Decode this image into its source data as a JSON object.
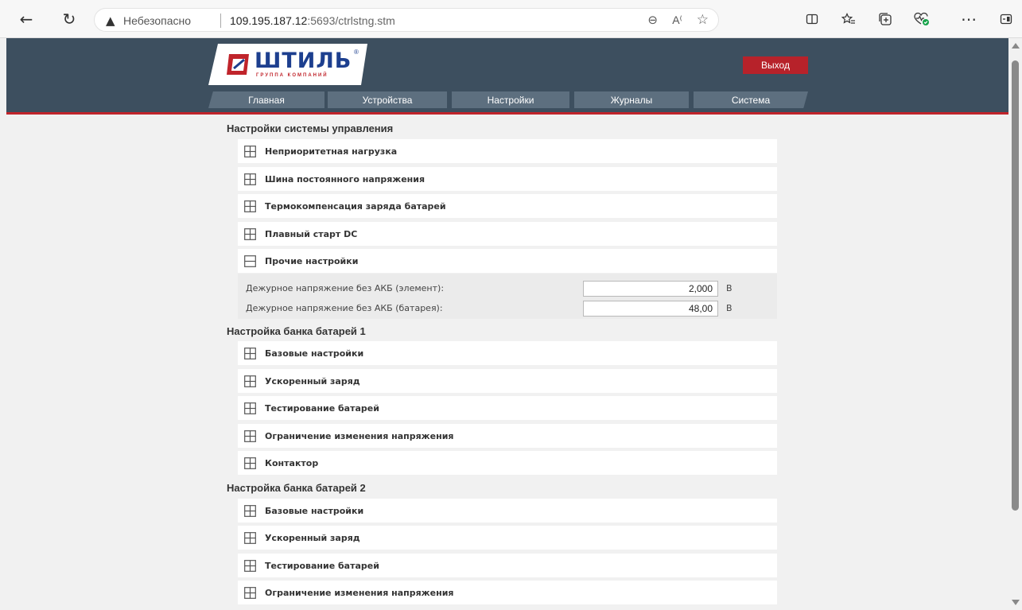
{
  "browser": {
    "back_icon": "arrow-left-icon",
    "reload_icon": "reload-icon",
    "security_label": "Небезопасно",
    "url_host": "109.195.187.12",
    "url_rest": ":5693/ctrlstng.stm",
    "toolbar_icons": [
      "split-screen-icon",
      "favorites-icon",
      "collections-icon",
      "health-icon",
      "more-icon",
      "sidebar-icon"
    ]
  },
  "header": {
    "logo_text": "ШТИЛЬ",
    "logo_registered": "®",
    "logo_subtitle": "ГРУППА КОМПАНИЙ",
    "exit_label": "Выход",
    "nav": [
      "Главная",
      "Устройства",
      "Настройки",
      "Журналы",
      "Система"
    ],
    "colors": {
      "header_bg": "#3d4f5f",
      "accent_red": "#c0242b",
      "tab_bg": "#5d6f7f"
    }
  },
  "control_system": {
    "title": "Настройки системы управления",
    "items": [
      "Неприоритетная нагрузка",
      "Шина постоянного напряжения",
      "Термокомпенсация заряда батарей",
      "Плавный старт DC",
      "Прочие настройки"
    ],
    "expanded_index": 4,
    "fields": [
      {
        "label": "Дежурное напряжение без АКБ (элемент):",
        "value": "2,000",
        "unit": "В"
      },
      {
        "label": "Дежурное напряжение без АКБ (батарея):",
        "value": "48,00",
        "unit": "В"
      }
    ]
  },
  "battery_bank_1": {
    "title": "Настройка банка батарей 1",
    "items": [
      "Базовые настройки",
      "Ускоренный заряд",
      "Тестирование батарей",
      "Ограничение изменения напряжения",
      "Контактор"
    ]
  },
  "battery_bank_2": {
    "title": "Настройка банка батарей 2",
    "items": [
      "Базовые настройки",
      "Ускоренный заряд",
      "Тестирование батарей",
      "Ограничение изменения напряжения"
    ]
  }
}
